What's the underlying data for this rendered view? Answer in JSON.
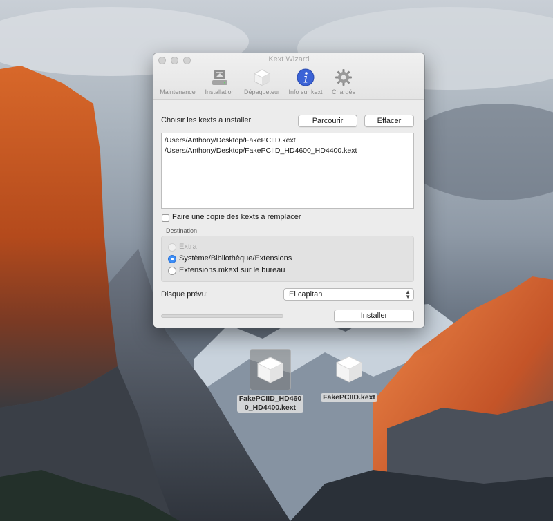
{
  "window": {
    "title": "Kext Wizard",
    "toolbar": [
      {
        "label": "Maintenance",
        "icon": "maintenance-icon"
      },
      {
        "label": "Installation",
        "icon": "disk-drive-icon"
      },
      {
        "label": "Dépaqueteur",
        "icon": "package-icon"
      },
      {
        "label": "Info sur kext",
        "icon": "info-icon"
      },
      {
        "label": "Chargés",
        "icon": "gear-icon"
      }
    ]
  },
  "install": {
    "choose_label": "Choisir les kexts à installer",
    "browse_label": "Parcourir",
    "clear_label": "Effacer",
    "files": [
      "/Users/Anthony/Desktop/FakePCIID.kext",
      "/Users/Anthony/Desktop/FakePCIID_HD4600_HD4400.kext"
    ],
    "copy_checkbox_label": "Faire une copie des kexts à remplacer",
    "destination_label": "Destination",
    "destinations": [
      {
        "label": "Extra",
        "state": "disabled"
      },
      {
        "label": "Système/Bibliothèque/Extensions",
        "state": "selected"
      },
      {
        "label": "Extensions.mkext sur le bureau",
        "state": "unselected"
      }
    ],
    "disk_label": "Disque prévu:",
    "disk_value": "El capitan",
    "progress": 0,
    "install_label": "Installer"
  },
  "desktop_icons": [
    {
      "name_line1": "FakePCIID_HD460",
      "name_line2": "0_HD4400.kext",
      "selected": true
    },
    {
      "name_line1": "FakePCIID.kext",
      "selected": false
    }
  ],
  "colors": {
    "accent": "#3d8ef7",
    "window_bg": "#ececec",
    "info_icon": "#3b63d6"
  }
}
